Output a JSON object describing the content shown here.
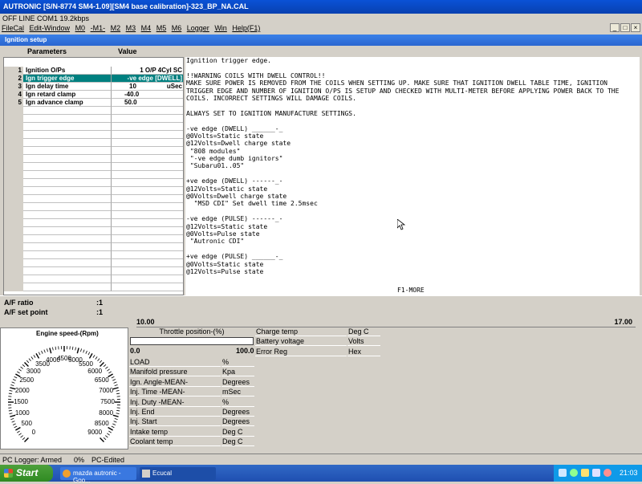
{
  "window": {
    "title": "AUTRONIC [S/N-8774 SM4-1.09][SM4 base calibration]-323_BP_NA.CAL",
    "status_line": "OFF LINE COM1 19.2kbps"
  },
  "menu": {
    "items": [
      "FileCal",
      "Edit-Window",
      "M0",
      "-M1-",
      "M2",
      "M3",
      "M4",
      "M5",
      "M6",
      "Logger",
      "Win",
      "Help(F1)"
    ]
  },
  "mdi_controls": {
    "minimize": "_",
    "restore": "□",
    "close": "×"
  },
  "child_window": {
    "title": "Ignition setup"
  },
  "param_table": {
    "header_params": "Parameters",
    "header_value": "Value",
    "rows": [
      {
        "num": "1",
        "name": "Ignition O/Ps",
        "value": "1 O/P 4Cyl SC",
        "selected": false
      },
      {
        "num": "2",
        "name": "Ign trigger edge",
        "value": "-ve edge [DWELL]",
        "selected": true
      },
      {
        "num": "3",
        "name": "Ign delay time",
        "value": "10",
        "unit": "uSec",
        "selected": false
      },
      {
        "num": "4",
        "name": "Ign retard clamp",
        "value": "-40.0",
        "selected": false
      },
      {
        "num": "5",
        "name": "Ign advance clamp",
        "value": "50.0",
        "selected": false
      }
    ]
  },
  "info_text": [
    "Ignition trigger edge.",
    "",
    "!!WARNING COILS WITH DWELL CONTROL!!",
    "MAKE SURE POWER IS REMOVED FROM THE COILS WHEN SETTING UP. MAKE SURE THAT IGNITION DWELL TABLE TIME, IGNITION",
    "TRIGGER EDGE AND NUMBER OF IGNITION O/PS IS SETUP AND CHECKED WITH MULTI-METER BEFORE APPLYING POWER BACK TO THE",
    "COILS. INCORRECT SETTINGS WILL DAMAGE COILS.",
    "",
    "ALWAYS SET TO IGNITION MANUFACTURE SETTINGS.",
    "",
    "-ve edge (DWELL) ______-_",
    "@0Volts=Static state",
    "@12Volts=Dwell charge state",
    " \"808 modules\"",
    " \"-ve edge dumb ignitors\"",
    " \"Subaru01..05\"",
    "",
    "+ve edge (DWELL) ------_-",
    "@12Volts=Static state",
    "@0Volts=Dwell charge state",
    "  \"MSD CDI\" Set dwell time 2.5msec",
    "",
    "-ve edge (PULSE) ------_-",
    "@12Volts=Static state",
    "@0Volts=Pulse state",
    " \"Autronic CDI\"",
    "",
    "+ve edge (PULSE) ______-_",
    "@0Volts=Static state",
    "@12Volts=Pulse state"
  ],
  "info_footer": "F1-MORE",
  "af": {
    "ratio_label": "A/F ratio",
    "ratio_value": ":1",
    "setpoint_label": "A/F set point",
    "setpoint_value": ":1",
    "scale_min": "10.00",
    "scale_max": "17.00"
  },
  "gauge": {
    "title": "Engine speed-(Rpm)",
    "ticks": [
      "0",
      "500",
      "1000",
      "1500",
      "2000",
      "2500",
      "3000",
      "3500",
      "4000",
      "4500",
      "5000",
      "5500",
      "6000",
      "6500",
      "7000",
      "7500",
      "8000",
      "8500",
      "9000"
    ]
  },
  "throttle": {
    "title": "Throttle position-(%)",
    "min": "0.0",
    "max": "100.0",
    "level": 0
  },
  "readouts_left": [
    {
      "label": "LOAD",
      "unit": "%"
    },
    {
      "label": "Manifold pressure",
      "unit": "Kpa"
    },
    {
      "label": "Ign. Angle-MEAN-",
      "unit": "Degrees"
    },
    {
      "label": "Inj. Time -MEAN-",
      "unit": "mSec"
    },
    {
      "label": "Inj. Duty -MEAN-",
      "unit": "%"
    },
    {
      "label": "Inj. End",
      "unit": "Degrees"
    },
    {
      "label": "Inj. Start",
      "unit": "Degrees"
    },
    {
      "label": "Intake temp",
      "unit": "Deg C"
    },
    {
      "label": "Coolant temp",
      "unit": "Deg C"
    }
  ],
  "readouts_right": [
    {
      "label": "Charge temp",
      "unit": "Deg C"
    },
    {
      "label": "Battery voltage",
      "unit": "Volts"
    },
    {
      "label": "Error Reg",
      "unit": "Hex"
    }
  ],
  "bottom_status": {
    "logger": "PC Logger: Armed",
    "percent": "0%",
    "edited": "PC-Edited"
  },
  "taskbar": {
    "start": "Start",
    "tasks": [
      "mazda autronic - Goo...",
      "Ecucal"
    ],
    "clock": "21:03"
  },
  "colors": {
    "selected_row": "#008080",
    "title_blue": "#0a52d6",
    "taskbar_blue": "#1f4fb0",
    "start_green": "#2f8a22"
  }
}
